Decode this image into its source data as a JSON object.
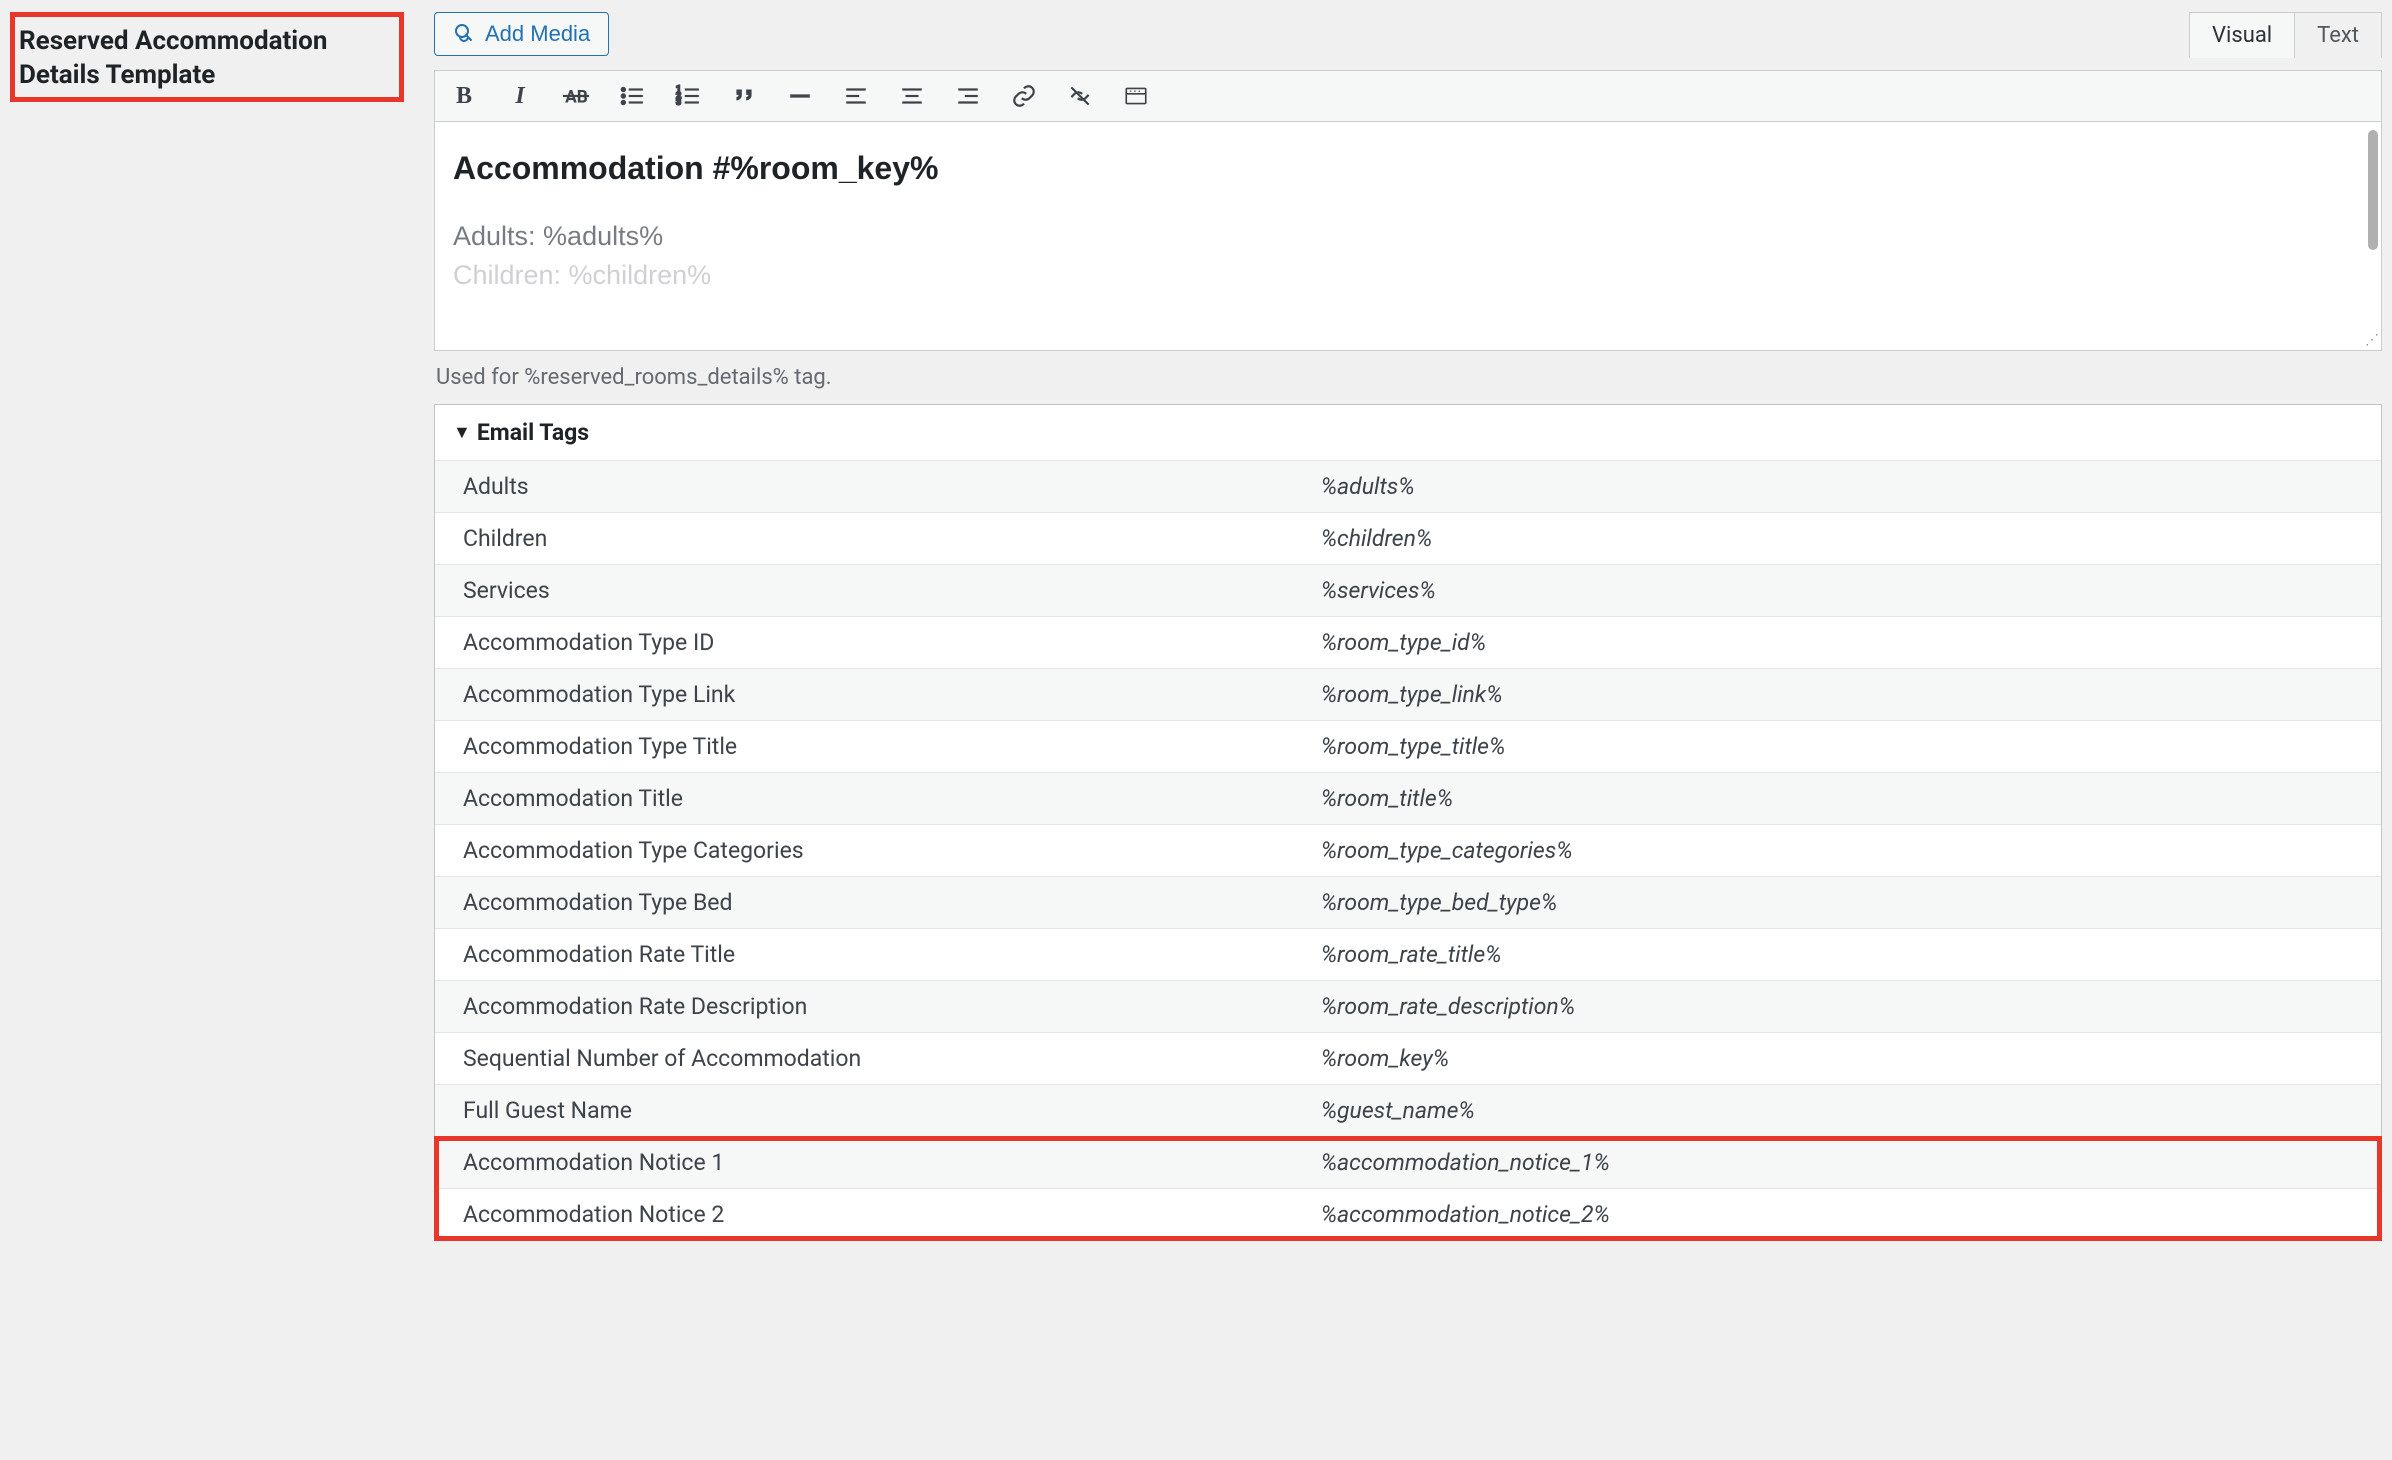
{
  "leftLabel": "Reserved Accommodation Details Template",
  "addMedia": "Add Media",
  "tabs": {
    "visual": "Visual",
    "text": "Text"
  },
  "editor": {
    "heading": "Accommodation #%room_key%",
    "line1": "Adults: %adults%",
    "line2": "Children: %children%"
  },
  "helper": "Used for %reserved_rooms_details% tag.",
  "emailTagsTitle": "Email Tags",
  "emailTags": [
    {
      "name": "Adults",
      "tag": "%adults%"
    },
    {
      "name": "Children",
      "tag": "%children%"
    },
    {
      "name": "Services",
      "tag": "%services%"
    },
    {
      "name": "Accommodation Type ID",
      "tag": "%room_type_id%"
    },
    {
      "name": "Accommodation Type Link",
      "tag": "%room_type_link%"
    },
    {
      "name": "Accommodation Type Title",
      "tag": "%room_type_title%"
    },
    {
      "name": "Accommodation Title",
      "tag": "%room_title%"
    },
    {
      "name": "Accommodation Type Categories",
      "tag": "%room_type_categories%"
    },
    {
      "name": "Accommodation Type Bed",
      "tag": "%room_type_bed_type%"
    },
    {
      "name": "Accommodation Rate Title",
      "tag": "%room_rate_title%"
    },
    {
      "name": "Accommodation Rate Description",
      "tag": "%room_rate_description%"
    },
    {
      "name": "Sequential Number of Accommodation",
      "tag": "%room_key%"
    },
    {
      "name": "Full Guest Name",
      "tag": "%guest_name%"
    },
    {
      "name": "Accommodation Notice 1",
      "tag": "%accommodation_notice_1%"
    },
    {
      "name": "Accommodation Notice 2",
      "tag": "%accommodation_notice_2%"
    }
  ]
}
